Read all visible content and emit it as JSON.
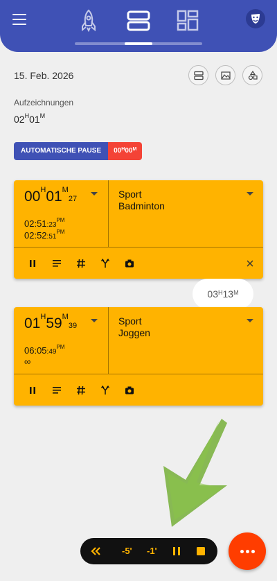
{
  "header": {
    "menu_icon": "hamburger-icon",
    "nav": [
      "rocket-icon",
      "list-view-icon",
      "dashboard-icon"
    ],
    "mask_icon": "theater-mask-icon",
    "brand_color": "#3f51b5"
  },
  "date": "15. Feb. 2026",
  "view_buttons": [
    "rows-icon",
    "landscape-icon",
    "shapes-icon"
  ],
  "recordings": {
    "label": "Aufzeichnungen",
    "value_h": "02",
    "value_m": "01"
  },
  "auto_pause": {
    "label": "AUTOMATISCHE PAUSE",
    "h": "00",
    "m": "00"
  },
  "cards": [
    {
      "dur_h": "00",
      "dur_m": "01",
      "dur_s": "27",
      "start_time": "02:51",
      "start_sec": ":23",
      "start_ampm": "PM",
      "end_time": "02:52",
      "end_sec": ":51",
      "end_ampm": "PM",
      "category": "Sport",
      "activity": "Badminton"
    },
    {
      "dur_h": "01",
      "dur_m": "59",
      "dur_s": "39",
      "start_time": "06:05",
      "start_sec": ":49",
      "start_ampm": "PM",
      "end_time": "∞",
      "category": "Sport",
      "activity": "Joggen"
    }
  ],
  "gap_total": {
    "h": "03",
    "m": "13"
  },
  "bottom_bar": {
    "rewind_icon": "double-chevron-left-icon",
    "minus5": "-5'",
    "minus1": "-1'",
    "pause_icon": "pause-icon",
    "stop_icon": "stop-icon"
  },
  "fab_icon": "more-dots-icon",
  "colors": {
    "card": "#ffb300",
    "accent_red": "#f44336",
    "fab": "#ff3d00"
  }
}
